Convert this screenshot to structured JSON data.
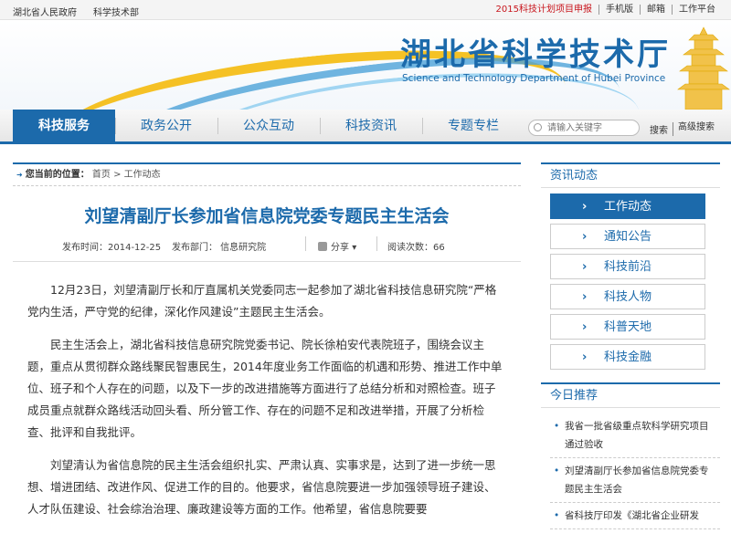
{
  "topbar": {
    "left_links": [
      "湖北省人民政府",
      "科学技术部"
    ],
    "right_links": [
      "2015科技计划项目申报",
      "手机版",
      "邮箱",
      "工作平台"
    ]
  },
  "header": {
    "title_cn": "湖北省科学技术厅",
    "title_en": "Science and Technology Department of Hubei Province"
  },
  "nav": {
    "items": [
      "科技服务",
      "政务公开",
      "公众互动",
      "科技资讯",
      "专题专栏"
    ],
    "active_index": 0,
    "search_placeholder": "请输入关键字",
    "search_label": "搜索",
    "advanced_search_label": "高级搜索"
  },
  "breadcrumb": {
    "label": "您当前的位置：",
    "home": "首页",
    "separator": ">",
    "current": "工作动态"
  },
  "article": {
    "title": "刘望清副厅长参加省信息院党委专题民主生活会",
    "publish_date": "发布时间：2014-12-25",
    "department": "发布部门： 信息研究院",
    "share_label": "分享",
    "views": "阅读次数：66",
    "paragraphs": [
      "12月23日，刘望清副厅长和厅直属机关党委同志一起参加了湖北省科技信息研究院“严格党内生活，严守党的纪律，深化作风建设”主题民主生活会。",
      "民主生活会上，湖北省科技信息研究院党委书记、院长徐柏安代表院班子，围绕会议主题，重点从贯彻群众路线聚民智惠民生，2014年度业务工作面临的机遇和形势、推进工作中单位、班子和个人存在的问题，以及下一步的改进措施等方面进行了总结分析和对照检查。班子成员重点就群众路线活动回头看、所分管工作、存在的问题不足和改进举措，开展了分析检查、批评和自我批评。",
      "刘望清认为省信息院的民主生活会组织扎实、严肃认真、实事求是，达到了进一步统一思想、增进团结、改进作风、促进工作的目的。他要求，省信息院要进一步加强领导班子建设、人才队伍建设、社会综治治理、廉政建设等方面的工作。他希望，省信息院要要"
    ]
  },
  "sidebar": {
    "section_title": "资讯动态",
    "menu": [
      "工作动态",
      "通知公告",
      "科技前沿",
      "科技人物",
      "科普天地",
      "科技金融"
    ],
    "active_index": 0,
    "recommend_title": "今日推荐",
    "recommend": [
      "我省一批省级重点软科学研究项目通过验收",
      "刘望清副厅长参加省信息院党委专题民主生活会",
      "省科技厅印发《湖北省企业研发"
    ]
  },
  "colors": {
    "brand_blue": "#1c6aab",
    "highlight_red": "#c8161d"
  }
}
